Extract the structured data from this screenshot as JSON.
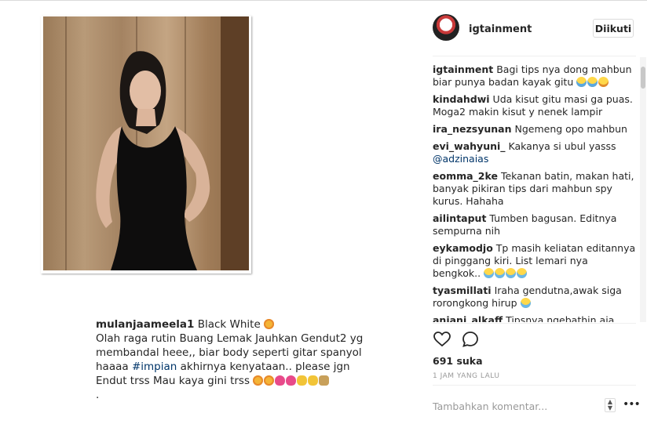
{
  "post": {
    "caption": {
      "user": "mulanjaameela1",
      "line1": "Black White",
      "line2": "Olah raga rutin Buang Lemak Jauhkan Gendut2 yg membandal heee,, biar body seperti gitar spanyol haaaa",
      "hashtag": "#impian",
      "line3": "akhirnya kenyataan.. please jgn Endut trss Mau kaya gini trss",
      "line4": "."
    }
  },
  "header": {
    "username": "igtainment",
    "follow_label": "Diikuti"
  },
  "comments": [
    {
      "user": "igtainment",
      "text": "Bagi tips nya dong mahbun biar punya badan kayak gitu",
      "emojis": [
        "scream",
        "scream",
        "smile"
      ]
    },
    {
      "user": "kindahdwi",
      "text": "Uda kisut gitu masi ga puas. Moga2 makin kisut y nenek lampir",
      "emojis": []
    },
    {
      "user": "ira_nezsyunan",
      "text": "Ngemeng opo mahbun",
      "emojis": []
    },
    {
      "user": "evi_wahyuni_",
      "text": "Kakanya si ubul yasss",
      "mention": "@adzinaias",
      "emojis": []
    },
    {
      "user": "eomma_2ke",
      "text": "Tekanan batin, makan hati, banyak pikiran tips dari mahbun spy kurus. Hahaha",
      "emojis": []
    },
    {
      "user": "ailintaput",
      "text": "Tumben bagusan. Editnya sempurna nih",
      "emojis": []
    },
    {
      "user": "eykamodjo",
      "text": "Tp masih keliatan editannya di pinggang kiri. List lemari nya bengkok..",
      "emojis": [
        "laugh",
        "laugh",
        "laugh",
        "laugh"
      ]
    },
    {
      "user": "tyasmillati",
      "text": "Iraha gendutna,awak siga rorongkong hirup",
      "emojis": [
        "laugh"
      ]
    },
    {
      "user": "anjani_alkaff",
      "text": "Tipsnya ngebathin aja",
      "emojis": []
    }
  ],
  "stats": {
    "likes": "691 suka",
    "time": "1 JAM YANG LALU"
  },
  "add_comment": {
    "placeholder": "Tambahkan komentar..."
  },
  "icons": {
    "like": "heart-icon",
    "comment": "comment-icon",
    "sort": "sort-icon",
    "more": "more-icon"
  }
}
